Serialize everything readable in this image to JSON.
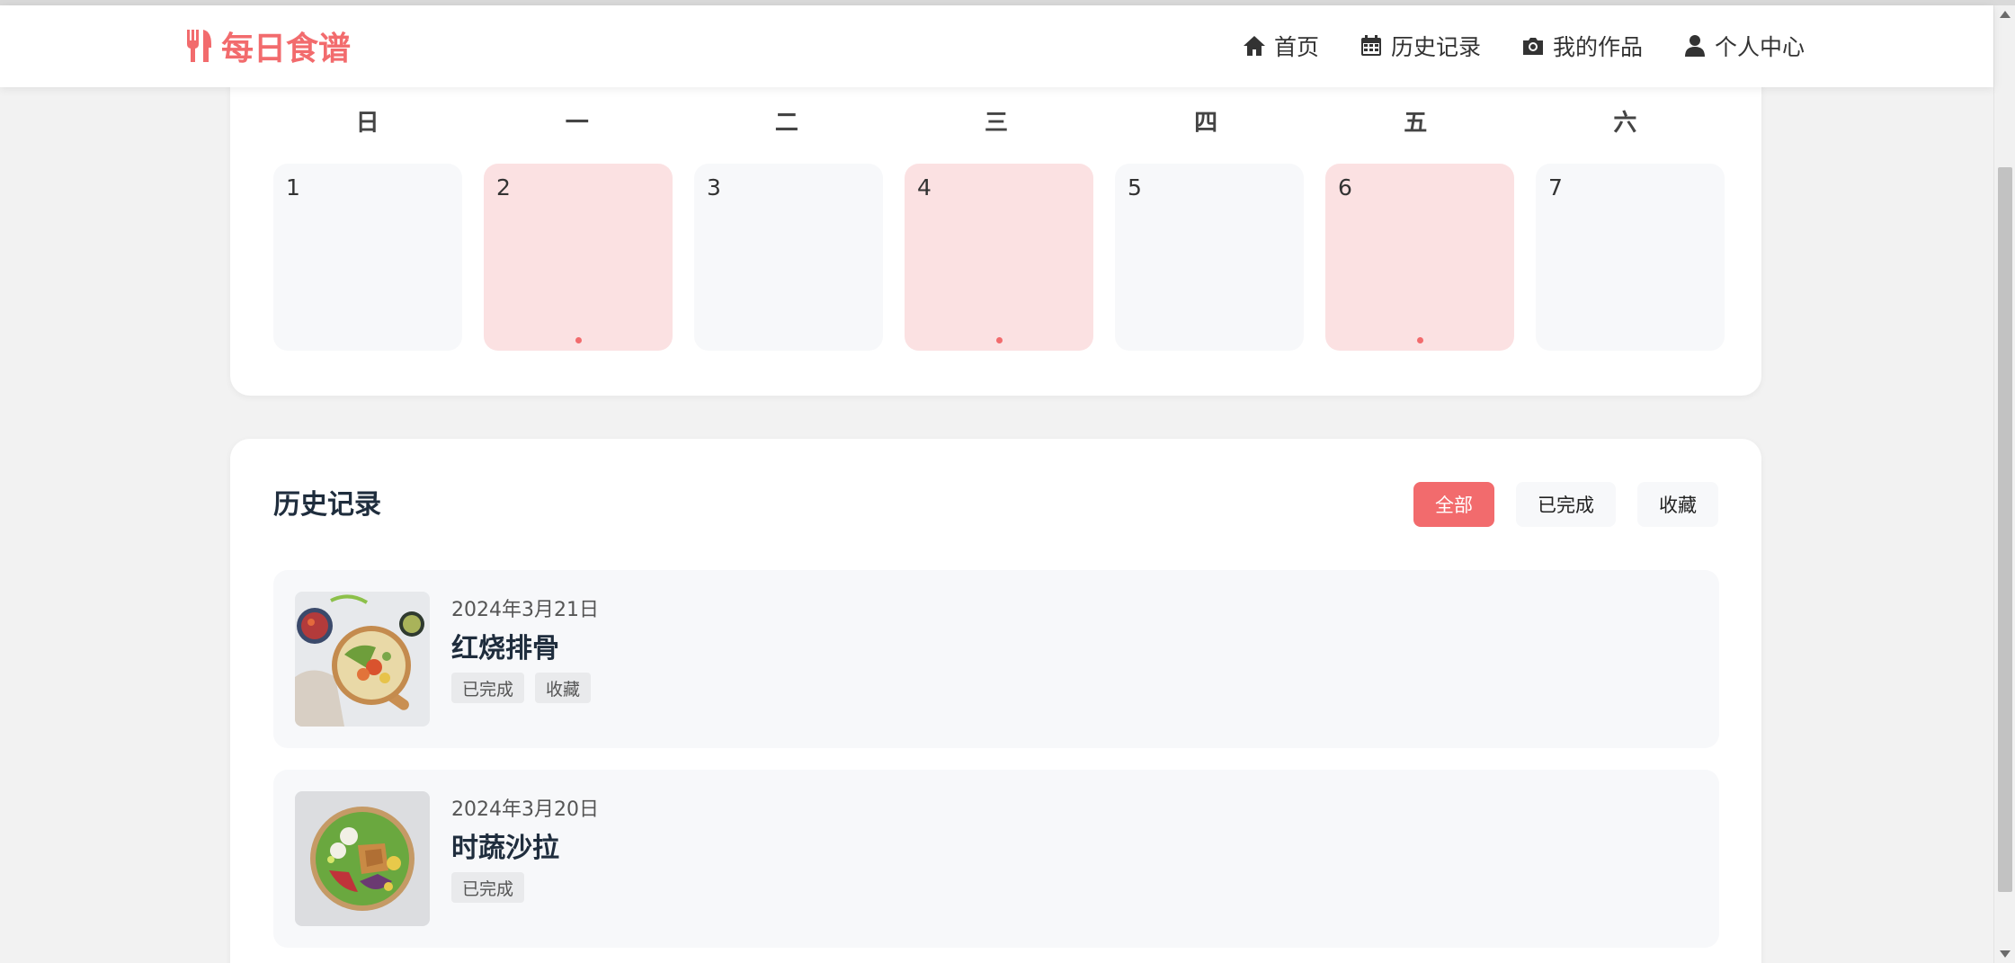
{
  "header": {
    "brand": "每日食谱",
    "nav": [
      {
        "label": "首页",
        "icon": "home-icon"
      },
      {
        "label": "历史记录",
        "icon": "calendar-icon"
      },
      {
        "label": "我的作品",
        "icon": "camera-icon"
      },
      {
        "label": "个人中心",
        "icon": "user-icon"
      }
    ]
  },
  "calendar": {
    "weekdays": [
      "日",
      "一",
      "二",
      "三",
      "四",
      "五",
      "六"
    ],
    "days": [
      {
        "day": "1",
        "has_record": false
      },
      {
        "day": "2",
        "has_record": true
      },
      {
        "day": "3",
        "has_record": false
      },
      {
        "day": "4",
        "has_record": true
      },
      {
        "day": "5",
        "has_record": false
      },
      {
        "day": "6",
        "has_record": true
      },
      {
        "day": "7",
        "has_record": false
      }
    ]
  },
  "history": {
    "title": "历史记录",
    "filters": [
      {
        "label": "全部",
        "active": true
      },
      {
        "label": "已完成",
        "active": false
      },
      {
        "label": "收藏",
        "active": false
      }
    ],
    "records": [
      {
        "date": "2024年3月21日",
        "title": "红烧排骨",
        "tags": [
          "已完成",
          "收藏"
        ]
      },
      {
        "date": "2024年3月20日",
        "title": "时蔬沙拉",
        "tags": [
          "已完成"
        ]
      }
    ]
  },
  "colors": {
    "accent": "#f26b6d",
    "active_day": "#fbe1e2",
    "cell_bg": "#f7f8fa"
  }
}
